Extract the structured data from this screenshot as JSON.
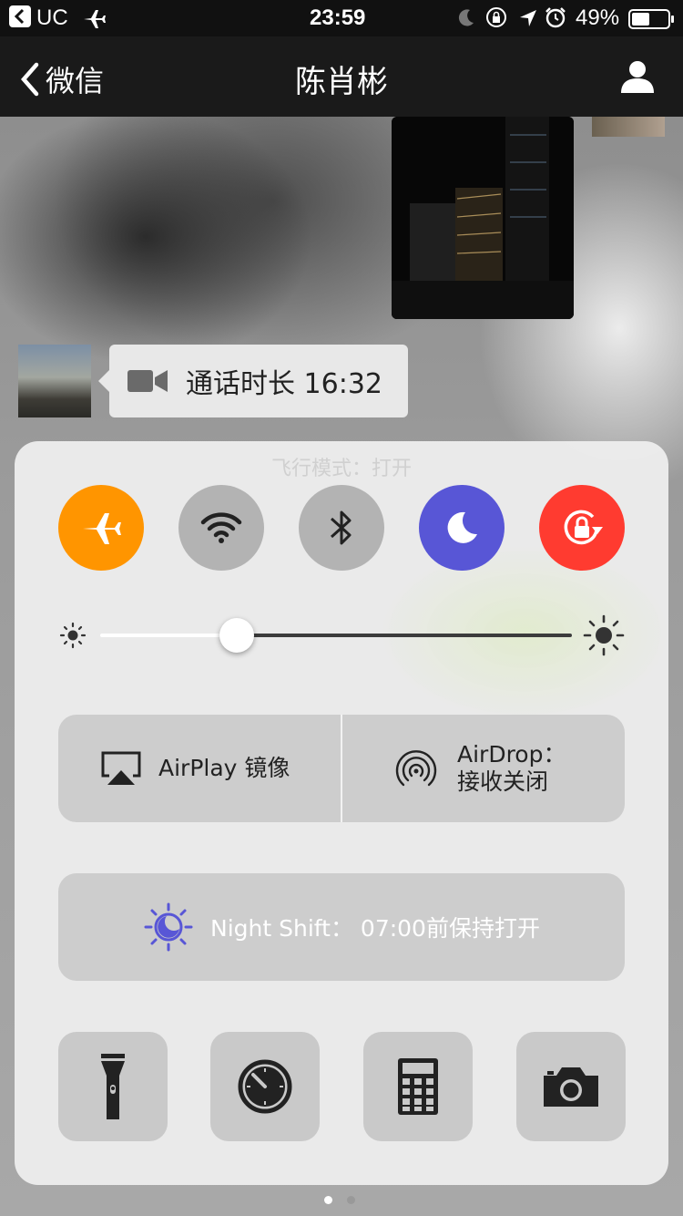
{
  "status_bar": {
    "carrier": "UC",
    "time": "23:59",
    "battery_percent": "49%",
    "battery_level": 0.49
  },
  "nav": {
    "back_label": "微信",
    "title": "陈肖彬"
  },
  "chat": {
    "call_text": "通话时长 16:32"
  },
  "control_center": {
    "ghost_text": "飞行模式：打开",
    "toggles": [
      {
        "name": "airplane-mode",
        "icon": "airplane-icon",
        "active": true,
        "color": "#FF9500"
      },
      {
        "name": "wifi",
        "icon": "wifi-icon",
        "active": false,
        "color": "#B3B3B3"
      },
      {
        "name": "bluetooth",
        "icon": "bluetooth-icon",
        "active": false,
        "color": "#B3B3B3"
      },
      {
        "name": "do-not-disturb",
        "icon": "moon-icon",
        "active": true,
        "color": "#5856D6"
      },
      {
        "name": "rotation-lock",
        "icon": "rotation-lock-icon",
        "active": true,
        "color": "#FF3B30"
      }
    ],
    "brightness_level": 0.29,
    "airplay_label": "AirPlay 镜像",
    "airdrop_label_1": "AirDrop：",
    "airdrop_label_2": "接收关闭",
    "night_shift_label": "Night Shift：  07:00前保持打开",
    "tools": [
      "flashlight-icon",
      "timer-icon",
      "calculator-icon",
      "camera-icon"
    ],
    "page_dots": {
      "count": 2,
      "active": 0
    }
  }
}
